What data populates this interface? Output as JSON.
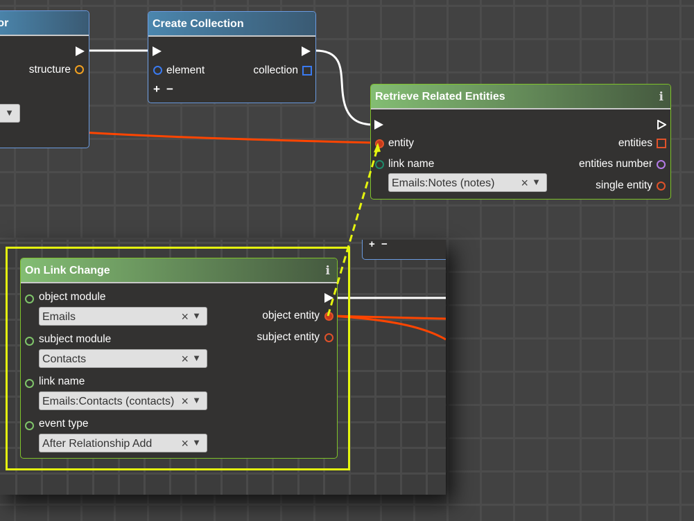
{
  "canvas": {
    "colors": {
      "flow_wire": "#ffffff",
      "entity_wire": "#ff4500",
      "selection": "#e5f50f",
      "node_border_blue": "#6b9be0",
      "node_border_green": "#7fc32a",
      "port_orange": "#f0a020",
      "port_blue": "#3a7af0",
      "port_red": "#e0522a",
      "port_teal": "#1f8a6a",
      "port_purple": "#b57be8",
      "port_green": "#7fc46a"
    }
  },
  "nodes": {
    "partial_left": {
      "title_fragment": "tor",
      "outputs": {
        "structure": "structure"
      }
    },
    "create_collection": {
      "title": "Create Collection",
      "inputs": {
        "element": "element"
      },
      "outputs": {
        "collection": "collection"
      },
      "add_label": "+",
      "remove_label": "−"
    },
    "retrieve_related": {
      "title": "Retrieve Related Entities",
      "info_icon": "i",
      "inputs": {
        "entity": "entity",
        "link_name": "link name",
        "link_name_value": "Emails:Notes (notes)"
      },
      "outputs": {
        "entities": "entities",
        "entities_number": "entities number",
        "single_entity": "single entity"
      }
    },
    "inset_partial": {
      "add_label": "+",
      "remove_label": "−"
    },
    "on_link_change": {
      "title": "On Link Change",
      "info_icon": "i",
      "fields": [
        {
          "label": "object module",
          "value": "Emails"
        },
        {
          "label": "subject module",
          "value": "Contacts"
        },
        {
          "label": "link name",
          "value": "Emails:Contacts (contacts)"
        },
        {
          "label": "event type",
          "value": "After Relationship Add"
        }
      ],
      "outputs": {
        "object_entity": "object entity",
        "subject_entity": "subject entity"
      }
    }
  },
  "icons": {
    "clear": "×",
    "caret": "▼",
    "info": "i"
  }
}
